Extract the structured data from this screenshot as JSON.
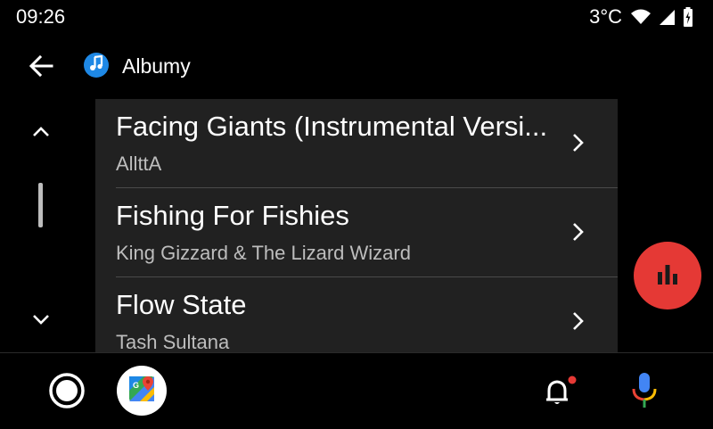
{
  "status": {
    "time": "09:26",
    "temperature": "3°C",
    "icons": [
      "wifi-icon",
      "cell-signal-icon",
      "battery-icon"
    ]
  },
  "header": {
    "title": "Albumy",
    "back_icon": "arrow-left-icon",
    "app_icon": "music-note-icon"
  },
  "scroll": {
    "up_icon": "chevron-up-icon",
    "down_icon": "chevron-down-icon"
  },
  "list": {
    "items": [
      {
        "title": "Facing Giants (Instrumental Versi...",
        "subtitle": "AllttA"
      },
      {
        "title": "Fishing For Fishies",
        "subtitle": "King Gizzard & The Lizard Wizard"
      },
      {
        "title": "Flow State",
        "subtitle": "Tash Sultana"
      }
    ]
  },
  "fab": {
    "icon": "equalizer-icon",
    "color": "#e53935"
  },
  "nav": {
    "home_icon": "home-circle-icon",
    "maps_icon": "google-maps-icon",
    "notification_icon": "bell-icon",
    "mic_icon": "microphone-icon",
    "notification_dot_color": "#e53935"
  }
}
